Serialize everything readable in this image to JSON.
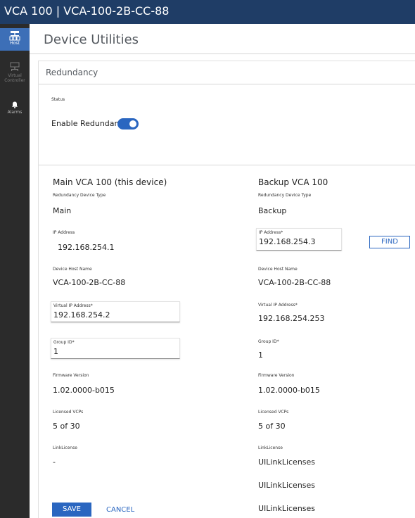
{
  "window": {
    "title": "VCA 100  |  VCA-100-2B-CC-88"
  },
  "nav": {
    "items": [
      {
        "label": "Host",
        "icon": "host-network-icon",
        "active": true
      },
      {
        "label": "Virtual Controller",
        "icon": "virtual-controller-icon",
        "active": false
      },
      {
        "label": "Alarms",
        "icon": "bell-icon",
        "active": false
      }
    ]
  },
  "page": {
    "title": "Device Utilities"
  },
  "redundancy": {
    "section_title": "Redundancy",
    "status_label": "Status",
    "enable_label": "Enable Redundancy",
    "enabled": true
  },
  "main_device": {
    "heading": "Main VCA 100 (this device)",
    "type_label": "Redundancy Device Type",
    "type_value": "Main",
    "ip_label": "IP Address",
    "ip_value": "192.168.254.1",
    "host_label": "Device Host Name",
    "host_value": "VCA-100-2B-CC-88",
    "vip_label": "Virtual IP Address*",
    "vip_value": "192.168.254.2",
    "group_label": "Group ID*",
    "group_value": "1",
    "fw_label": "Firmware Version",
    "fw_value": "1.02.0000-b015",
    "vcp_label": "Licensed VCPs",
    "vcp_value": "5 of 30",
    "link_label": "LinkLicense",
    "link_value": "-"
  },
  "backup_device": {
    "heading": "Backup VCA 100",
    "type_label": "Redundancy Device Type",
    "type_value": "Backup",
    "ip_label": "IP Address*",
    "ip_value": "192.168.254.3",
    "find_label": "FIND",
    "host_label": "Device Host Name",
    "host_value": "VCA-100-2B-CC-88",
    "vip_label": "Virtual IP Address*",
    "vip_value": "192.168.254.253",
    "group_label": "Group ID*",
    "group_value": "1",
    "fw_label": "Firmware Version",
    "fw_value": "1.02.0000-b015",
    "vcp_label": "Licensed VCPs",
    "vcp_value": "5 of 30",
    "link_label": "LinkLicense",
    "link_values": [
      "UILinkLicenses",
      "UILinkLicenses",
      "UILinkLicenses"
    ]
  },
  "actions": {
    "save_label": "SAVE",
    "cancel_label": "CANCEL"
  },
  "colors": {
    "titlebar": "#1f3d66",
    "nav_bg": "#2b2b2b",
    "nav_active": "#3d6fb7",
    "accent": "#2a66c0"
  }
}
